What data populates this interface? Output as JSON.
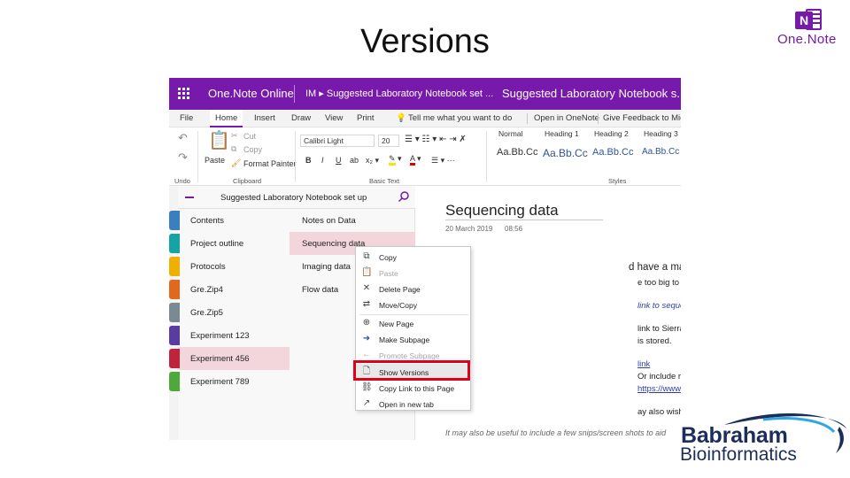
{
  "slide": {
    "title": "Versions"
  },
  "logos": {
    "onenote_text": "One.Note",
    "onenote_letter": "N",
    "babraham_line1": "Babraham",
    "babraham_line2": "Bioinformatics"
  },
  "app": {
    "name": "One.Note Online",
    "breadcrumb": "IM ▸ Suggested Laboratory Notebook set ...",
    "doc_title": "Suggested Laboratory Notebook s..."
  },
  "tabs": [
    "File",
    "Home",
    "Insert",
    "Draw",
    "View",
    "Print"
  ],
  "active_tab": "Home",
  "tellme": "Tell me what you want to do",
  "open_in_onenote": "Open in OneNote",
  "feedback": "Give Feedback to Micro",
  "ribbon": {
    "undo_label": "Undo",
    "paste": "Paste",
    "cut": "Cut",
    "copy": "Copy",
    "format_painter": "Format Painter",
    "clipboard_label": "Clipboard",
    "font_name": "Calibri Light",
    "font_size": "20",
    "basic_text_label": "Basic Text",
    "styles_label": "Styles",
    "styles": [
      {
        "name": "Normal",
        "sample": "Aa.Bb.Cc"
      },
      {
        "name": "Heading 1",
        "sample": "Aa.Bb.Cc"
      },
      {
        "name": "Heading 2",
        "sample": "Aa.Bb.Cc"
      },
      {
        "name": "Heading 3",
        "sample": "Aa.Bb.Cc"
      }
    ]
  },
  "nav": {
    "title": "Suggested Laboratory Notebook set up",
    "sections": [
      {
        "label": "Contents",
        "color": "#3a7fc0"
      },
      {
        "label": "Project outline",
        "color": "#16a3a3"
      },
      {
        "label": "Protocols",
        "color": "#f0b000"
      },
      {
        "label": "Gre.Zip4",
        "color": "#e0691c"
      },
      {
        "label": "Gre.Zip5",
        "color": "#7a8a93"
      },
      {
        "label": "Experiment 123",
        "color": "#5b3aa3"
      },
      {
        "label": "Experiment 456",
        "color": "#c0243a"
      },
      {
        "label": "Experiment 789",
        "color": "#4ea83a"
      }
    ],
    "selected_section": "Experiment 456",
    "pages": [
      "Notes on Data",
      "Sequencing data",
      "Imaging data",
      "Flow data"
    ],
    "selected_page": "Sequencing data"
  },
  "page": {
    "title": "Sequencing data",
    "date": "20 March 2019",
    "time": "08:56",
    "line1": "d have a master list of sequencing expe",
    "line2": "e too big to embed.",
    "line3": "link to sequencing LIMS",
    "line4": "link to Sierra (although the person reading/accessing w",
    "line5": "is stored.",
    "line6": "link",
    "line7": "Or include reference to it eg",
    "line8": "https://www.bioinformatics.babraham.ac.uk/sierra/sierr",
    "line9": "ay also wish to take screen shots of sequencing QC etc, b",
    "line10": "It may also be useful to include a few snips/screen shots to aid"
  },
  "context_menu": {
    "items": [
      {
        "label": "Copy",
        "icon": "copy-icon",
        "disabled": false
      },
      {
        "label": "Paste",
        "icon": "paste-icon",
        "disabled": true
      },
      {
        "label": "Delete Page",
        "icon": "close-icon",
        "disabled": false
      },
      {
        "label": "Move/Copy",
        "icon": "move-icon",
        "disabled": false
      },
      {
        "label": "New Page",
        "icon": "plus-icon",
        "disabled": false
      },
      {
        "label": "Make Subpage",
        "icon": "arrow-right-icon",
        "disabled": false
      },
      {
        "label": "Promote Subpage",
        "icon": "arrow-left-icon",
        "disabled": true
      },
      {
        "label": "Show Versions",
        "icon": "versions-icon",
        "disabled": false
      },
      {
        "label": "Copy Link to this Page",
        "icon": "link-icon",
        "disabled": false
      },
      {
        "label": "Open in new tab",
        "icon": "open-tab-icon",
        "disabled": false
      }
    ],
    "highlighted": "Show Versions"
  },
  "colors": {
    "accent": "#7719aa",
    "highlight_box": "#e0001a",
    "selected_row": "#f3d6dc"
  }
}
